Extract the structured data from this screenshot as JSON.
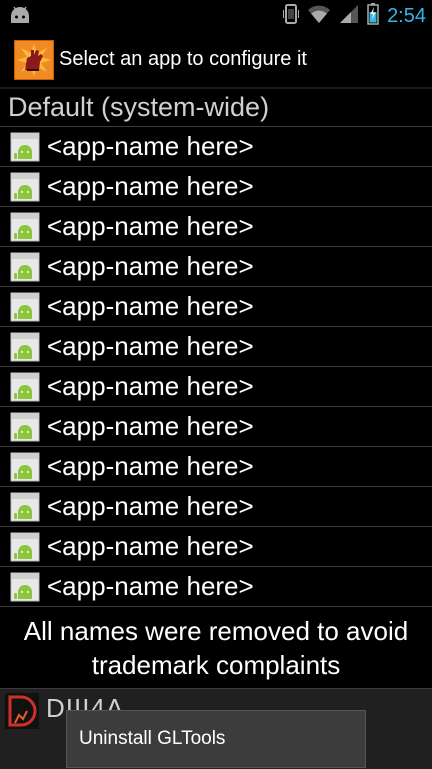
{
  "status_bar": {
    "time": "2:54"
  },
  "action_bar": {
    "title": "Select an app to configure it"
  },
  "list": {
    "default_label": "Default (system-wide)",
    "apps": [
      "<app-name here>",
      "<app-name here>",
      "<app-name here>",
      "<app-name here>",
      "<app-name here>",
      "<app-name here>",
      "<app-name here>",
      "<app-name here>",
      "<app-name here>",
      "<app-name here>",
      "<app-name here>",
      "<app-name here>"
    ]
  },
  "notice": {
    "line1": "All names were removed to avoid",
    "line2": "trademark complaints"
  },
  "bottom": {
    "partial_name": "DIII4A"
  },
  "toast": {
    "text": "Uninstall GLTools"
  },
  "colors": {
    "clock": "#33b5e5",
    "divider": "#3a3a3a",
    "android_green": "#8cc63f"
  }
}
